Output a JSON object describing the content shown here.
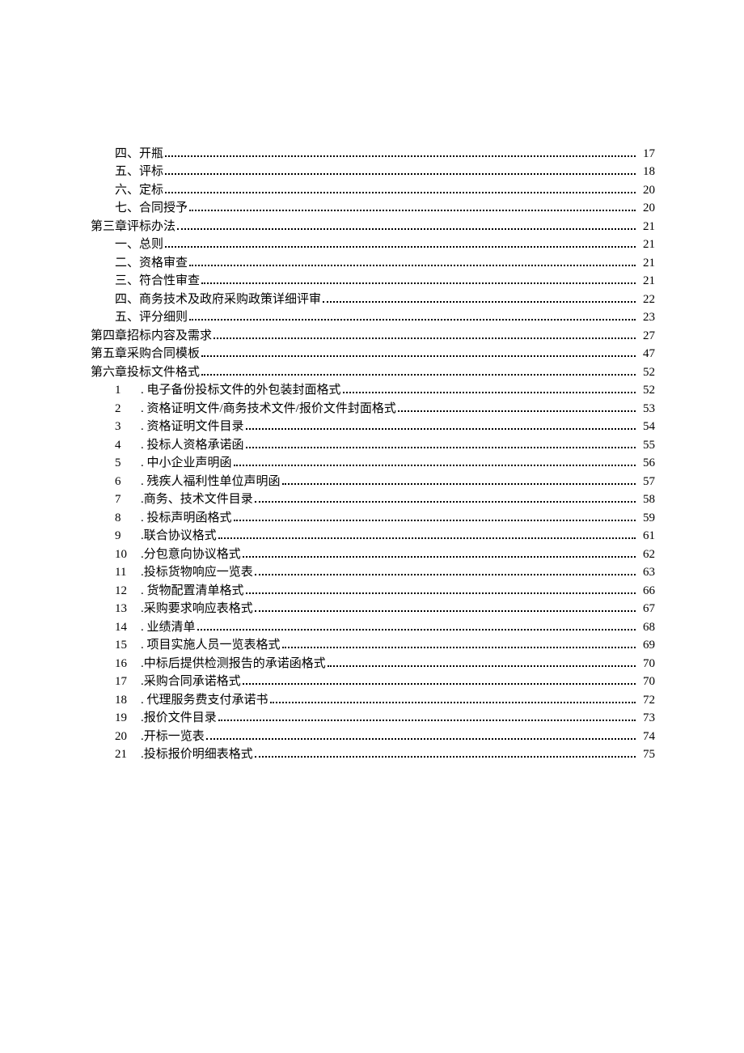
{
  "toc": [
    {
      "indent": 1,
      "num": "",
      "label": "四、开瓶",
      "page": "17"
    },
    {
      "indent": 1,
      "num": "",
      "label": "五、评标",
      "page": "18"
    },
    {
      "indent": 1,
      "num": "",
      "label": "六、定标",
      "page": "20"
    },
    {
      "indent": 1,
      "num": "",
      "label": "七、合同授予",
      "page": "20"
    },
    {
      "indent": 0,
      "num": "",
      "label": "第三章评标办法",
      "page": "21"
    },
    {
      "indent": 1,
      "num": "",
      "label": "一、总则",
      "page": "21"
    },
    {
      "indent": 1,
      "num": "",
      "label": "二、资格审查",
      "page": "21"
    },
    {
      "indent": 1,
      "num": "",
      "label": "三、符合性审查",
      "page": "21"
    },
    {
      "indent": 1,
      "num": "",
      "label": "四、商务技术及政府采购政策详细评审",
      "page": "22"
    },
    {
      "indent": 1,
      "num": "",
      "label": "五、评分细则",
      "page": "23"
    },
    {
      "indent": 0,
      "num": "",
      "label": "第四章招标内容及需求",
      "page": "27"
    },
    {
      "indent": 0,
      "num": "",
      "label": "第五章采购合同模板",
      "page": "47"
    },
    {
      "indent": 0,
      "num": "",
      "label": "第六章投标文件格式",
      "page": "52"
    },
    {
      "indent": 1,
      "num": "1",
      "label": ". 电子备份投标文件的外包装封面格式 ",
      "page": "52"
    },
    {
      "indent": 1,
      "num": "2",
      "label": ". 资格证明文件/商务技术文件/报价文件封面格式 ",
      "page": "53"
    },
    {
      "indent": 1,
      "num": "3",
      "label": ". 资格证明文件目录 ",
      "page": "54"
    },
    {
      "indent": 1,
      "num": "4",
      "label": ". 投标人资格承诺函",
      "page": "55"
    },
    {
      "indent": 1,
      "num": "5",
      "label": ". 中小企业声明函",
      "page": "56"
    },
    {
      "indent": 1,
      "num": "6",
      "label": ". 残疾人福利性单位声明函",
      "page": "57"
    },
    {
      "indent": 1,
      "num": "7",
      "label": ".商务、技术文件目录 ",
      "page": "58"
    },
    {
      "indent": 1,
      "num": "8",
      "label": ". 投标声明函格式",
      "page": "59"
    },
    {
      "indent": 1,
      "num": "9",
      "label": ".联合协议格式 ",
      "page": "61"
    },
    {
      "indent": 1,
      "num": "10",
      "label": ".分包意向协议格式 ",
      "page": "62"
    },
    {
      "indent": 1,
      "num": "11",
      "label": ".投标货物响应一览表",
      "page": "63"
    },
    {
      "indent": 1,
      "num": "12",
      "label": ". 货物配置清单格式",
      "page": "66"
    },
    {
      "indent": 1,
      "num": "13",
      "label": ".采购要求响应表格式",
      "page": "67"
    },
    {
      "indent": 1,
      "num": "14",
      "label": ". 业绩清单 ",
      "page": "68"
    },
    {
      "indent": 1,
      "num": "15",
      "label": ". 项目实施人员一览表格式 ",
      "page": "69"
    },
    {
      "indent": 1,
      "num": "16",
      "label": ".中标后提供检测报告的承诺函格式 ",
      "page": "70"
    },
    {
      "indent": 1,
      "num": "17",
      "label": ".采购合同承诺格式",
      "page": "70"
    },
    {
      "indent": 1,
      "num": "18",
      "label": ". 代理服务费支付承诺书 ",
      "page": "72"
    },
    {
      "indent": 1,
      "num": "19",
      "label": ".报价文件目录 ",
      "page": "73"
    },
    {
      "indent": 1,
      "num": "20",
      "label": ".开标一览表 ",
      "page": "74"
    },
    {
      "indent": 1,
      "num": "21",
      "label": ".投标报价明细表格式",
      "page": "75"
    }
  ]
}
